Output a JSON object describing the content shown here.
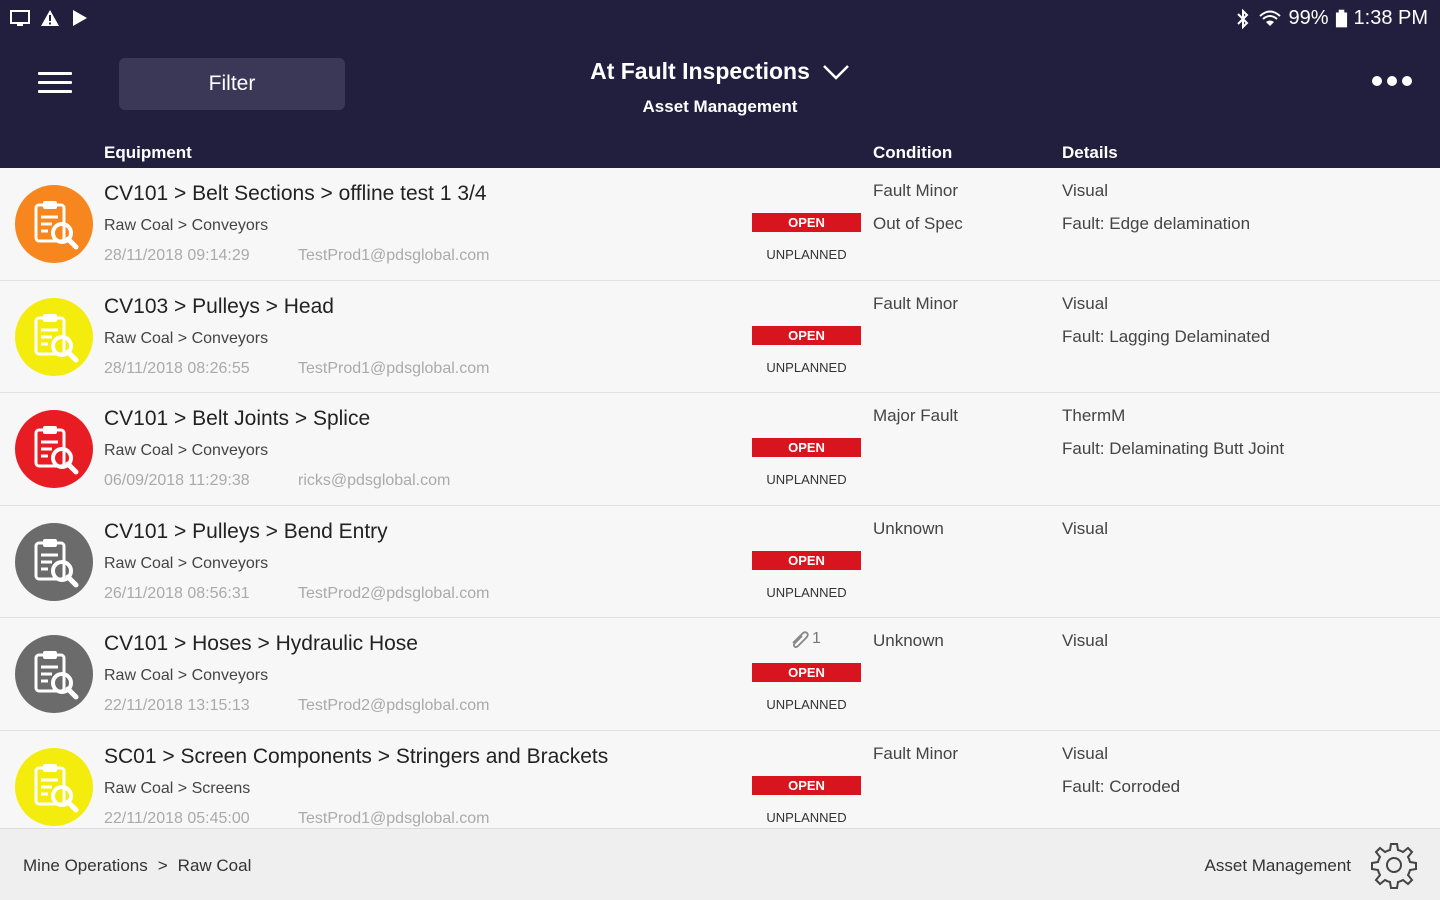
{
  "statusbar": {
    "battery": "99%",
    "time": "1:38 PM",
    "colors": {
      "bg": "#221f3e"
    }
  },
  "appbar": {
    "filter_label": "Filter",
    "title": "At Fault Inspections",
    "subtitle": "Asset Management"
  },
  "columns": {
    "equipment": "Equipment",
    "condition": "Condition",
    "details": "Details"
  },
  "rows": [
    {
      "title": "CV101 > Belt Sections > offline test 1 3/4",
      "sub": "Raw Coal > Conveyors",
      "date": "28/11/2018 09:14:29",
      "user": "TestProd1@pdsglobal.com",
      "status": "OPEN",
      "type": "UNPLANNED",
      "cond1": "Fault Minor",
      "cond2": "Out of Spec",
      "det1": "Visual",
      "det2": "Fault: Edge delamination",
      "color": "#f7861e",
      "attach": ""
    },
    {
      "title": "CV103 > Pulleys > Head",
      "sub": "Raw Coal > Conveyors",
      "date": "28/11/2018 08:26:55",
      "user": "TestProd1@pdsglobal.com",
      "status": "OPEN",
      "type": "UNPLANNED",
      "cond1": "Fault Minor",
      "cond2": "",
      "det1": "Visual",
      "det2": "Fault: Lagging Delaminated",
      "color": "#f4ec0c",
      "attach": ""
    },
    {
      "title": "CV101 > Belt Joints > Splice",
      "sub": "Raw Coal > Conveyors",
      "date": "06/09/2018 11:29:38",
      "user": "ricks@pdsglobal.com",
      "status": "OPEN",
      "type": "UNPLANNED",
      "cond1": "Major Fault",
      "cond2": "",
      "det1": "ThermM",
      "det2": "Fault: Delaminating Butt Joint",
      "color": "#e81d24",
      "attach": ""
    },
    {
      "title": "CV101 > Pulleys > Bend Entry",
      "sub": "Raw Coal > Conveyors",
      "date": "26/11/2018 08:56:31",
      "user": "TestProd2@pdsglobal.com",
      "status": "OPEN",
      "type": "UNPLANNED",
      "cond1": "Unknown",
      "cond2": "",
      "det1": "Visual",
      "det2": "",
      "color": "#6b6b6b",
      "attach": ""
    },
    {
      "title": "CV101 > Hoses > Hydraulic Hose",
      "sub": "Raw Coal > Conveyors",
      "date": "22/11/2018 13:15:13",
      "user": "TestProd2@pdsglobal.com",
      "status": "OPEN",
      "type": "UNPLANNED",
      "cond1": "Unknown",
      "cond2": "",
      "det1": "Visual",
      "det2": "",
      "color": "#6b6b6b",
      "attach": "1"
    },
    {
      "title": "SC01 > Screen Components > Stringers and Brackets",
      "sub": "Raw Coal > Screens",
      "date": "22/11/2018 05:45:00",
      "user": "TestProd1@pdsglobal.com",
      "status": "OPEN",
      "type": "UNPLANNED",
      "cond1": "Fault Minor",
      "cond2": "",
      "det1": "Visual",
      "det2": "Fault: Corroded",
      "color": "#f4ec0c",
      "attach": ""
    }
  ],
  "footer": {
    "crumb1": "Mine Operations",
    "sep": ">",
    "crumb2": "Raw Coal",
    "right_label": "Asset Management"
  },
  "icons": {
    "avatar": "clipboard-search-icon",
    "menu": "hamburger-icon",
    "more": "more-dots-icon",
    "dropdown": "chevron-down-icon",
    "settings": "gear-icon",
    "attachment": "paperclip-icon"
  }
}
